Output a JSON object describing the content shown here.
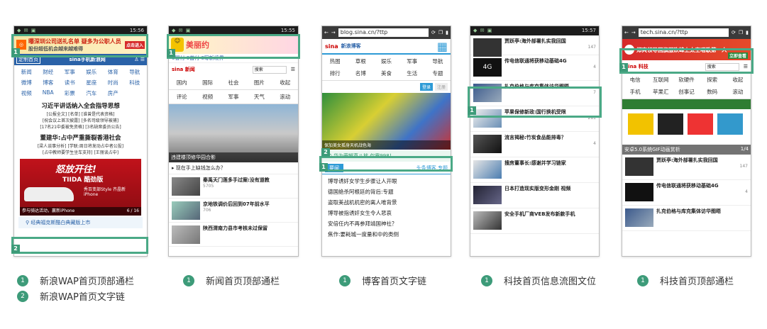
{
  "phone1": {
    "status_time": "15:56",
    "ad_text": "曝深圳公司送礼名单 疑多为公职人员",
    "ad_sub": "股份超低机会越来越难得",
    "ad_btn": "点击进入",
    "logo": "sina手机新浪网",
    "custom": "定制首页",
    "menu": [
      "新闻",
      "财经",
      "军事",
      "娱乐",
      "体育",
      "导航",
      "微博",
      "博客",
      "读书",
      "星座",
      "时尚",
      "科技",
      "视频",
      "NBA",
      "彩票",
      "汽车",
      "房产"
    ],
    "headline1": "习近平讲话纳入全会指导思想",
    "links1": [
      "[公报全文]",
      "[名单]",
      "[谁曾是代表资格]",
      "[祝会议上首次披露]",
      "[多名司级领导被捕]",
      "[17名21中委被免资格]",
      "[3名缺席委员公告]"
    ],
    "headline2": "董建华:占中严重撕裂香港社会",
    "links2": [
      "[梁人谈事分析]",
      "[学联:周日将发动占中者公投]",
      "[占中教师要学生坐车支持]",
      "[王丽谈占中]"
    ],
    "banner_text1": "怒放开往!",
    "banner_text2": "TIIDA 酷劲版",
    "banner_text3": "秀百变部Style 齐晶新iPhone",
    "banner_caption": "参与骑达活动，赢新iPhone",
    "banner_page": "6 / 16",
    "text_link": "经典福克斯酷白典藏版上市",
    "badge1": "1",
    "badge2": "2"
  },
  "phone2": {
    "status_time": "15:55",
    "ad_text": "美丽约",
    "ticker": "0冒付 0首付 0写新境界",
    "logo": "sina 新闻",
    "search": "搜索",
    "nav": [
      "国内",
      "国际",
      "社会",
      "图片",
      "收起"
    ],
    "nav2": [
      "评论",
      "视频",
      "军事",
      "天气",
      "滚动"
    ],
    "img_caption": "违建楼顶修华园合影",
    "list_title": "现在手上缺钱怎么办？",
    "items": [
      {
        "title": "秦禹天门莲多手过案:没有道教",
        "meta": "5705"
      },
      {
        "title": "京地铁调价后回到07年前水平",
        "meta": "706"
      },
      {
        "title": "陕西渭南力县市考核未过保留",
        "meta": ""
      }
    ],
    "badge": "1"
  },
  "phone3": {
    "url": "blog.sina.cn/?ttp",
    "logo": "新浪博客",
    "nav": [
      "热图",
      "草根",
      "娱乐",
      "军事",
      "导航",
      "排行",
      "名博",
      "美食",
      "生活",
      "专题"
    ],
    "login": "登录",
    "register": "注册",
    "img_caption": "保加美女孤身天机战色海",
    "text_link": "华为荣耀真八核 仅需998！",
    "section": "要闻",
    "section_links": "头条博客 专题",
    "items": [
      "博导诱奸女学生步骤让人开眼",
      "德国绝杀阿根廷的背后:专题",
      "盗取美战机机密的离人唯背景",
      "博导被指诱奸女生令人悲哀",
      "安倍任内不再参拜靖国神社？",
      "焦作:要耗城一度量和中的类侧"
    ],
    "badge1": "1",
    "badge2": "2"
  },
  "phone4": {
    "status_time": "15:57",
    "items": [
      {
        "title": "贾跃亭:海外部署扎实我回国",
        "meta": "147"
      },
      {
        "title": "传电信联通将获移动基础4G",
        "meta": "4"
      },
      {
        "title": "扎克伯格与库克集体访华图晤",
        "meta": "7"
      },
      {
        "title": "苹果保修新政:国行换机受限",
        "meta": "281"
      },
      {
        "title": "流言揭秘:竹炭食品能排毒？",
        "meta": "4"
      },
      {
        "title": "搜房董事长:感谢并学习链家",
        "meta": ""
      },
      {
        "title": "日本打造现实版变形金刚 视频",
        "meta": ""
      },
      {
        "title": "安全手机厂商VEB发布新款手机",
        "meta": ""
      }
    ],
    "badge": "1"
  },
  "phone5": {
    "url": "tech.sina.cn/?ttp",
    "ad_text": "郑爽领导国旗服砍峰上太空唱歌第一人",
    "ad_btn": "立即查看",
    "logo": "sina 科技",
    "search": "搜索",
    "nav": [
      "电信",
      "互联网",
      "软硬件",
      "探索",
      "收起",
      "手机",
      "苹果汇",
      "创事记",
      "数码",
      "滚动"
    ],
    "img_caption": "安卓5.0系统GIF动画赏析",
    "img_page": "1/4",
    "items": [
      {
        "title": "贾跃亭:海外部署扎实我回国",
        "meta": "147"
      },
      {
        "title": "传电信联通将获移动基础4G",
        "meta": "4"
      },
      {
        "title": "扎克伯格与库克集体访华图晤",
        "meta": ""
      }
    ],
    "badge": "1"
  },
  "captions": [
    {
      "num": "1",
      "text": "新浪WAP首页顶部通栏"
    },
    {
      "num": "2",
      "text": "新浪WAP首页文字链"
    },
    {
      "num": "1",
      "text": "新闻首页顶部通栏"
    },
    {
      "num": "1",
      "text": "博客首页文字链"
    },
    {
      "num": "1",
      "text": "科技首页信息流图文位"
    },
    {
      "num": "1",
      "text": "科技首页顶部通栏"
    }
  ],
  "colors": {
    "accent": "#3d9b79",
    "sina_blue": "#2a62a8",
    "ad_red": "#d62a2a"
  }
}
